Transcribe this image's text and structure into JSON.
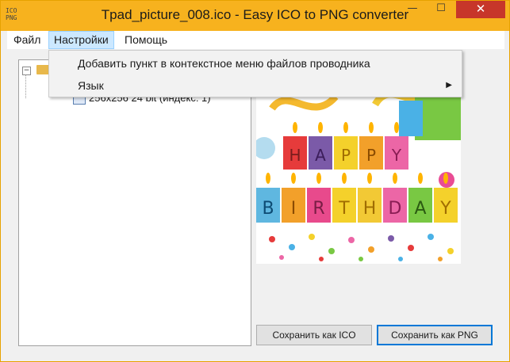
{
  "window": {
    "title": "Tpad_picture_008.ico - Easy ICO to PNG converter",
    "app_icon_text": [
      "ICO",
      "PNG"
    ],
    "minimize_glyph": "—",
    "maximize_glyph": "☐",
    "close_glyph": "✕"
  },
  "menubar": {
    "file": "Файл",
    "settings": "Настройки",
    "help": "Помощь"
  },
  "settings_menu": {
    "items": [
      {
        "label": "Добавить пункт в контекстное меню файлов проводника"
      },
      {
        "label": "Язык",
        "submenu_arrow": "▶"
      }
    ]
  },
  "tree": {
    "expander": "−",
    "child_label": "256x256 24 bit (индекс: 1)"
  },
  "preview": {
    "top_row_letters": [
      "H",
      "A",
      "P",
      "P",
      "Y"
    ],
    "bottom_row_letters": [
      "B",
      "I",
      "R",
      "T",
      "H",
      "D",
      "A",
      "Y"
    ]
  },
  "buttons": {
    "save_ico": "Сохранить как ICO",
    "save_png": "Сохранить как PNG"
  },
  "colors": {
    "titlebar": "#f7b21e",
    "close_button": "#c7362a",
    "menu_highlight": "#cce8ff",
    "default_button_border": "#0078d7"
  }
}
